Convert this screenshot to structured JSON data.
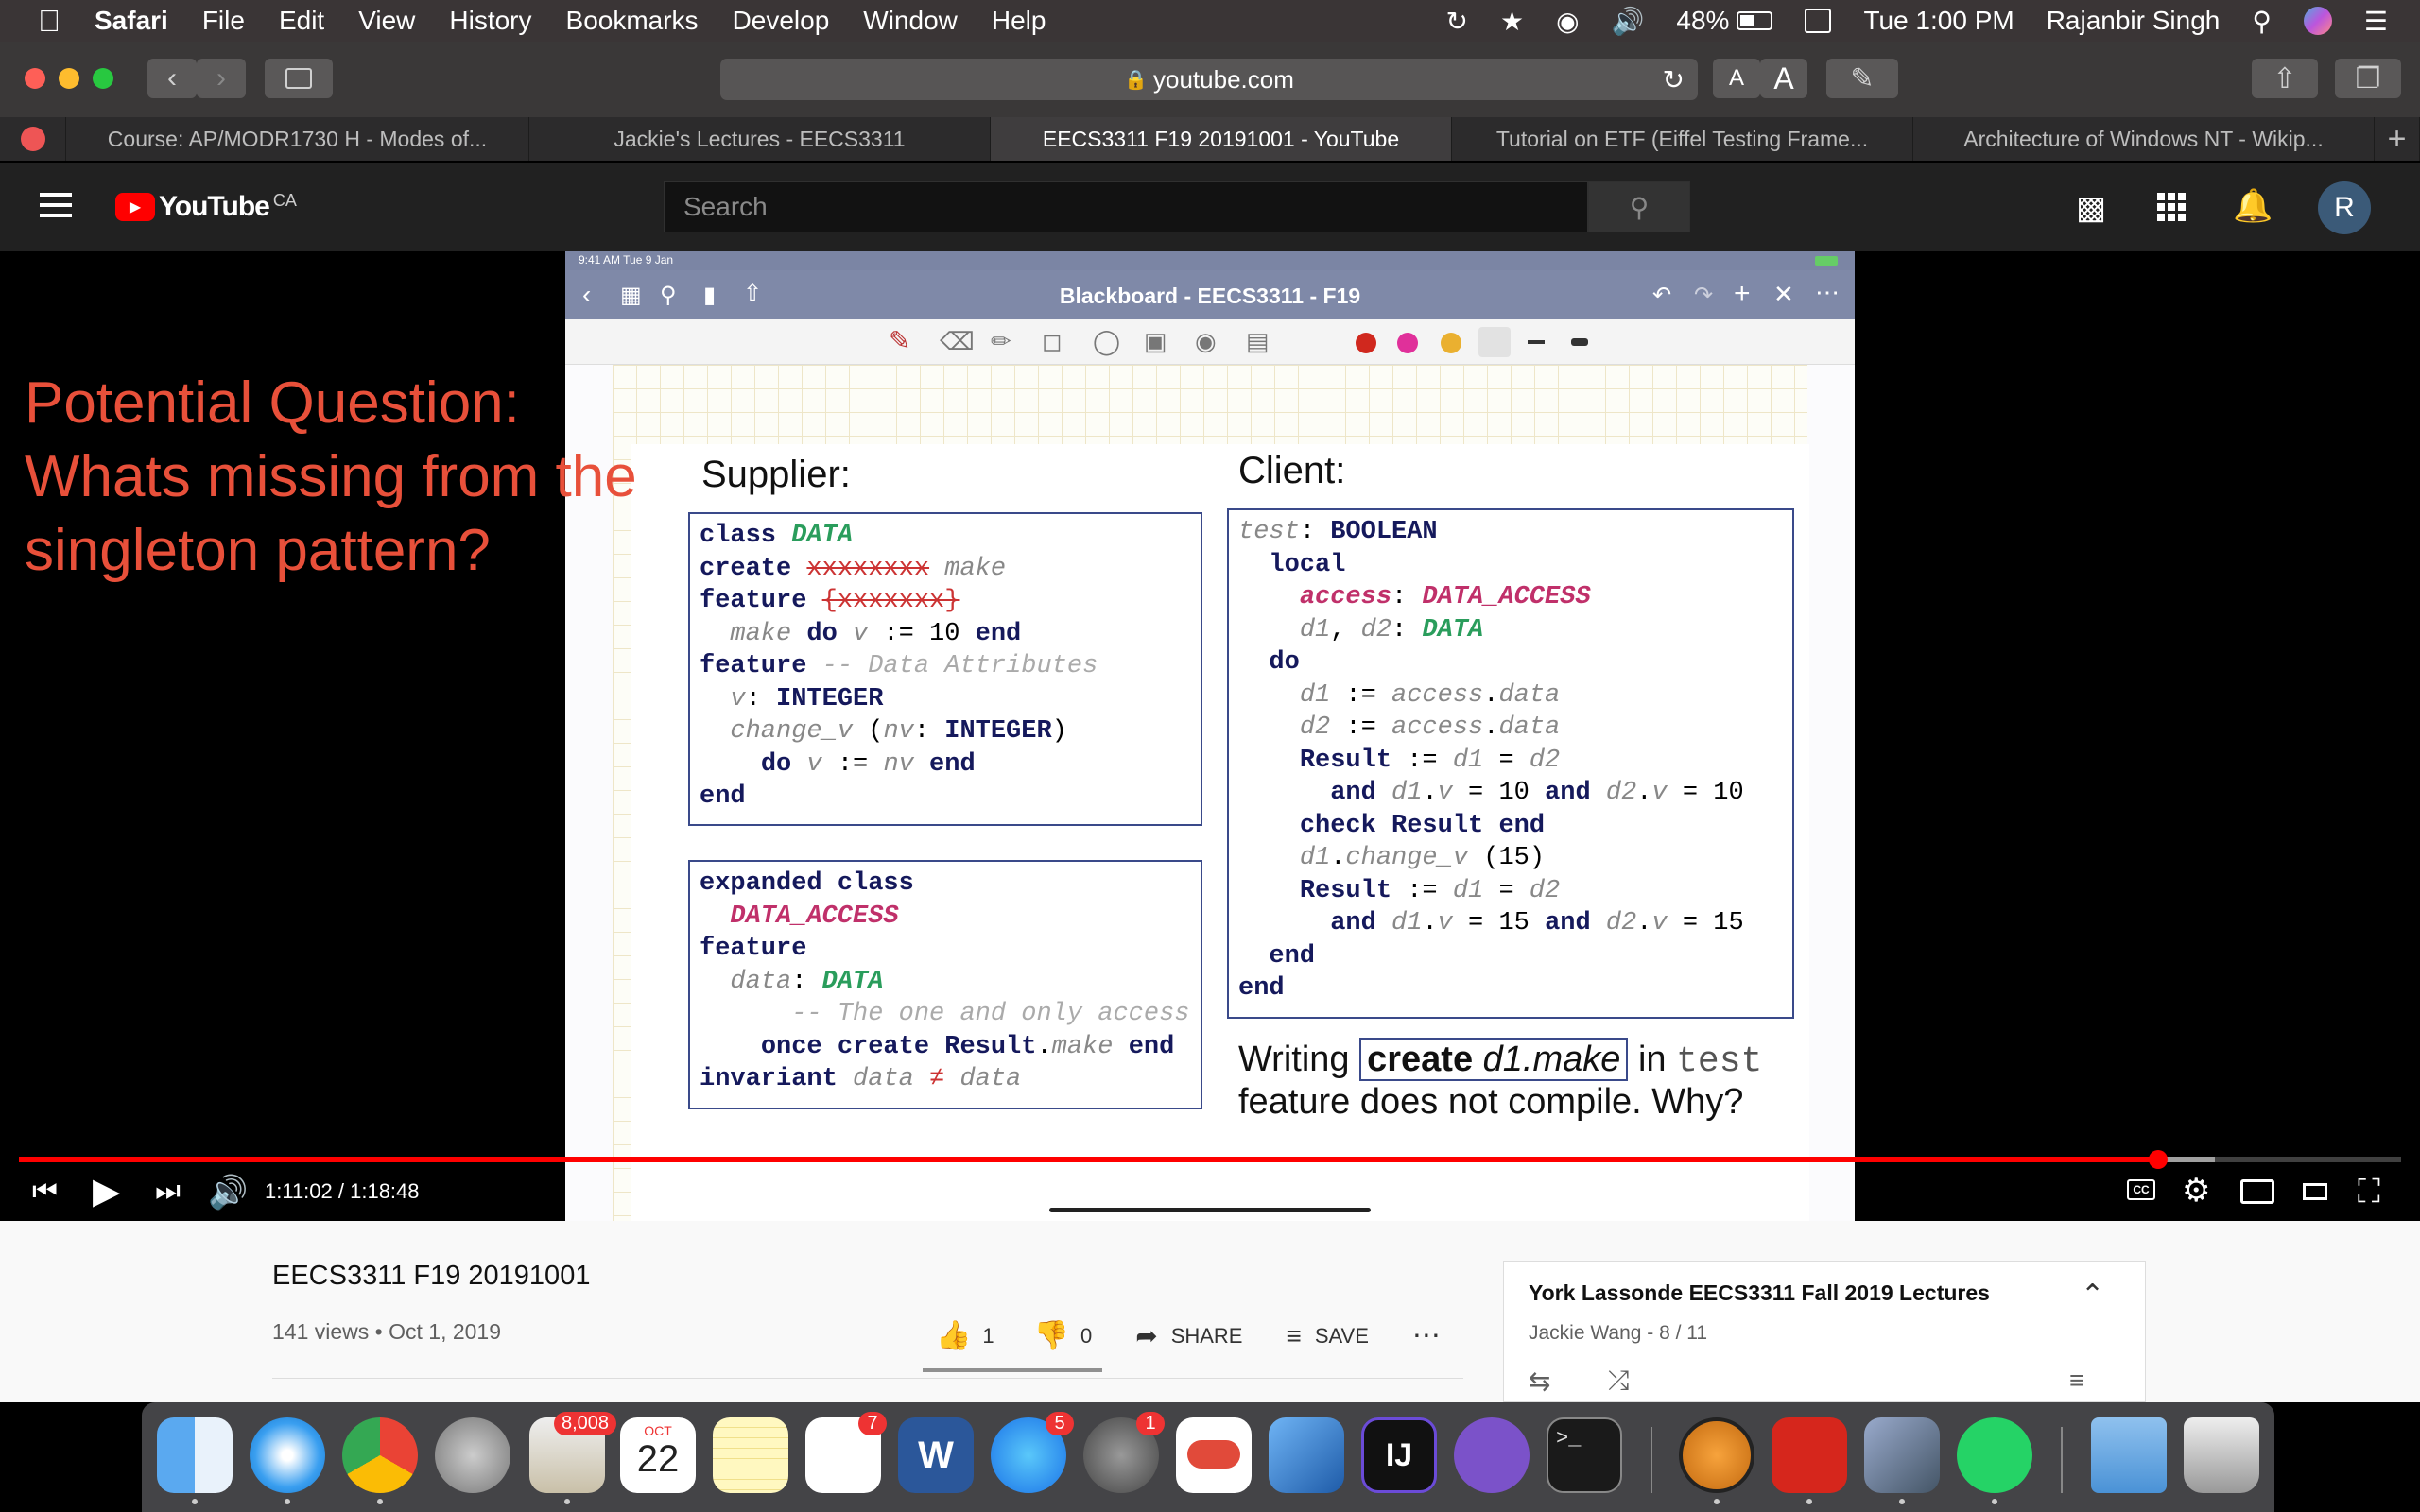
{
  "menubar": {
    "apple_icon": "apple-logo",
    "items": [
      "Safari",
      "File",
      "Edit",
      "View",
      "History",
      "Bookmarks",
      "Develop",
      "Window",
      "Help"
    ],
    "battery": "48%",
    "clock": "Tue 1:00 PM",
    "user": "Rajanbir Singh"
  },
  "safari": {
    "url": "youtube.com",
    "text_small": "A",
    "text_large": "A"
  },
  "tabs": [
    {
      "label": "Course: AP/MODR1730 H - Modes of..."
    },
    {
      "label": "Jackie's Lectures - EECS3311"
    },
    {
      "label": "EECS3311 F19 20191001 - YouTube"
    },
    {
      "label": "Tutorial on ETF (Eiffel Testing Frame..."
    },
    {
      "label": "Architecture of Windows NT - Wikip..."
    }
  ],
  "youtube": {
    "logo": "YouTube",
    "country": "CA",
    "search_placeholder": "Search",
    "avatar_letter": "R"
  },
  "video": {
    "overlay_lines": [
      "Potential Question:",
      "Whats missing from the",
      "singleton pattern?"
    ],
    "ipad_status": "9:41 AM  Tue 9 Jan",
    "ipad_title": "Blackboard - EECS3311 - F19",
    "supplier_heading": "Supplier:",
    "client_heading": "Client:",
    "footer_line1_pre": "Writing",
    "footer_boxed_kw": "create",
    "footer_boxed_rest": "d1.make",
    "footer_line1_post": "in",
    "footer_line1_mono": "test",
    "footer_line2": "feature does not compile. Why?",
    "time": "1:11:02 / 1:18:48",
    "progress": 0.898
  },
  "info": {
    "title": "EECS3311 F19 20191001",
    "views": "141 views • Oct 1, 2019",
    "likes": "1",
    "dislikes": "0",
    "share": "SHARE",
    "save": "SAVE",
    "playlist_title": "York Lassonde EECS3311 Fall 2019 Lectures",
    "playlist_sub": "Jackie Wang - 8 / 11"
  },
  "dock": {
    "mail_badge": "8,008",
    "calendar_month": "OCT",
    "calendar_day": "22",
    "reminders_badge": "7",
    "appstore_badge": "5",
    "prefs_badge": "1",
    "word_letter": "W",
    "intellij_letters": "IJ",
    "terminal_prompt": ">_"
  }
}
